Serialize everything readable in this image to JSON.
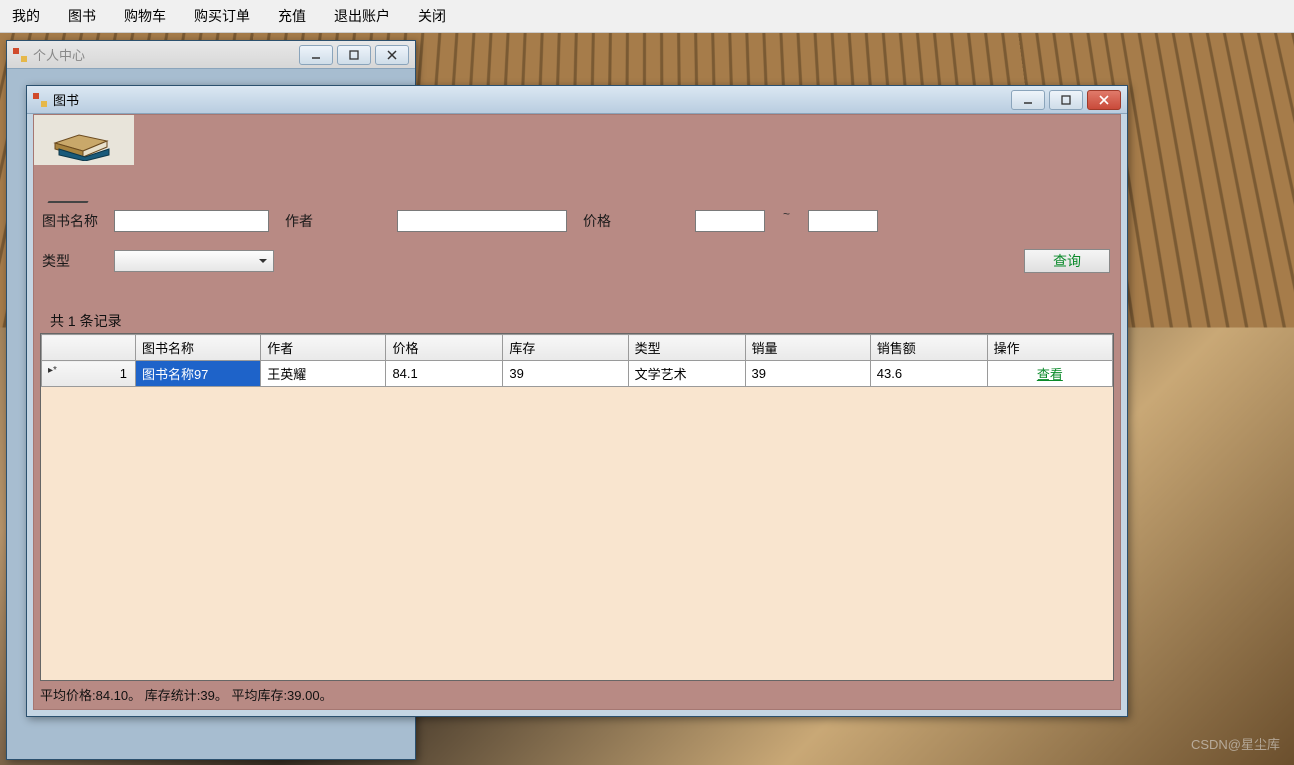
{
  "menubar": [
    "我的",
    "图书",
    "购物车",
    "购买订单",
    "充值",
    "退出账户",
    "关闭"
  ],
  "parent_window": {
    "title": "个人中心"
  },
  "child_window": {
    "title": "图书"
  },
  "search": {
    "name_label": "图书名称",
    "author_label": "作者",
    "price_label": "价格",
    "range_sep": "~",
    "type_label": "类型",
    "name_value": "",
    "author_value": "",
    "price_from": "",
    "price_to": "",
    "type_value": "",
    "query_btn": "查询"
  },
  "record_count_text": "共 1 条记录",
  "grid": {
    "headers": [
      "图书名称",
      "作者",
      "价格",
      "库存",
      "类型",
      "销量",
      "销售额",
      "操作"
    ],
    "row_marker": "▸*",
    "row_index": "1",
    "rows": [
      {
        "name": "图书名称97",
        "author": "王英耀",
        "price": "84.1",
        "stock": "39",
        "type": "文学艺术",
        "sales": "39",
        "revenue": "43.6",
        "op": "查看"
      }
    ]
  },
  "status": "平均价格:84.10。 库存统计:39。 平均库存:39.00。",
  "watermark": "CSDN@星尘库"
}
